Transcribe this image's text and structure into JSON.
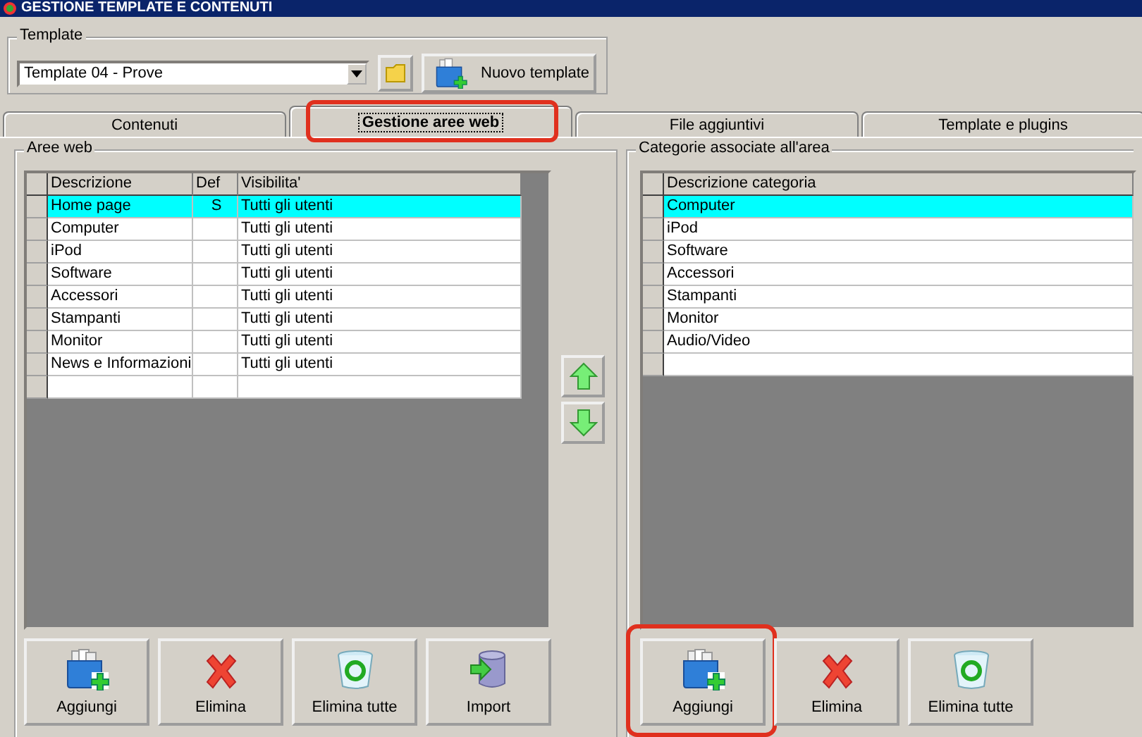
{
  "window": {
    "title": "GESTIONE TEMPLATE E CONTENUTI"
  },
  "template_group": {
    "label": "Template",
    "dropdown_value": "Template 04 - Prove",
    "new_button": "Nuovo template"
  },
  "tabs": [
    {
      "label": "Contenuti",
      "selected": false,
      "highlighted": false
    },
    {
      "label": "Gestione aree web",
      "selected": true,
      "highlighted": true
    },
    {
      "label": "File aggiuntivi",
      "selected": false,
      "highlighted": false
    },
    {
      "label": "Template e plugins",
      "selected": false,
      "highlighted": false
    }
  ],
  "aree_web": {
    "label": "Aree web",
    "columns": [
      "Descrizione",
      "Def",
      "Visibilita'"
    ],
    "rows": [
      {
        "cells": [
          "Home page",
          "S",
          "Tutti gli utenti"
        ],
        "selected": true
      },
      {
        "cells": [
          "Computer",
          "",
          "Tutti gli utenti"
        ],
        "selected": false
      },
      {
        "cells": [
          "iPod",
          "",
          "Tutti gli utenti"
        ],
        "selected": false
      },
      {
        "cells": [
          "Software",
          "",
          "Tutti gli utenti"
        ],
        "selected": false
      },
      {
        "cells": [
          "Accessori",
          "",
          "Tutti gli utenti"
        ],
        "selected": false
      },
      {
        "cells": [
          "Stampanti",
          "",
          "Tutti gli utenti"
        ],
        "selected": false
      },
      {
        "cells": [
          "Monitor",
          "",
          "Tutti gli utenti"
        ],
        "selected": false
      },
      {
        "cells": [
          "News e Informazioni",
          "",
          "Tutti gli utenti"
        ],
        "selected": false
      }
    ],
    "buttons": [
      {
        "label": "Aggiungi",
        "kind": "add",
        "highlighted": false
      },
      {
        "label": "Elimina",
        "kind": "delete",
        "highlighted": false
      },
      {
        "label": "Elimina tutte",
        "kind": "bin",
        "highlighted": false
      },
      {
        "label": "Import",
        "kind": "import",
        "highlighted": false
      }
    ]
  },
  "categorie": {
    "label": "Categorie associate all'area",
    "columns": [
      "Descrizione categoria"
    ],
    "rows": [
      {
        "cells": [
          "Computer"
        ],
        "selected": true
      },
      {
        "cells": [
          "iPod"
        ],
        "selected": false
      },
      {
        "cells": [
          "Software"
        ],
        "selected": false
      },
      {
        "cells": [
          "Accessori"
        ],
        "selected": false
      },
      {
        "cells": [
          "Stampanti"
        ],
        "selected": false
      },
      {
        "cells": [
          "Monitor"
        ],
        "selected": false
      },
      {
        "cells": [
          "Audio/Video"
        ],
        "selected": false
      }
    ],
    "buttons": [
      {
        "label": "Aggiungi",
        "kind": "add",
        "highlighted": true
      },
      {
        "label": "Elimina",
        "kind": "delete",
        "highlighted": false
      },
      {
        "label": "Elimina tutte",
        "kind": "bin",
        "highlighted": false
      }
    ]
  }
}
